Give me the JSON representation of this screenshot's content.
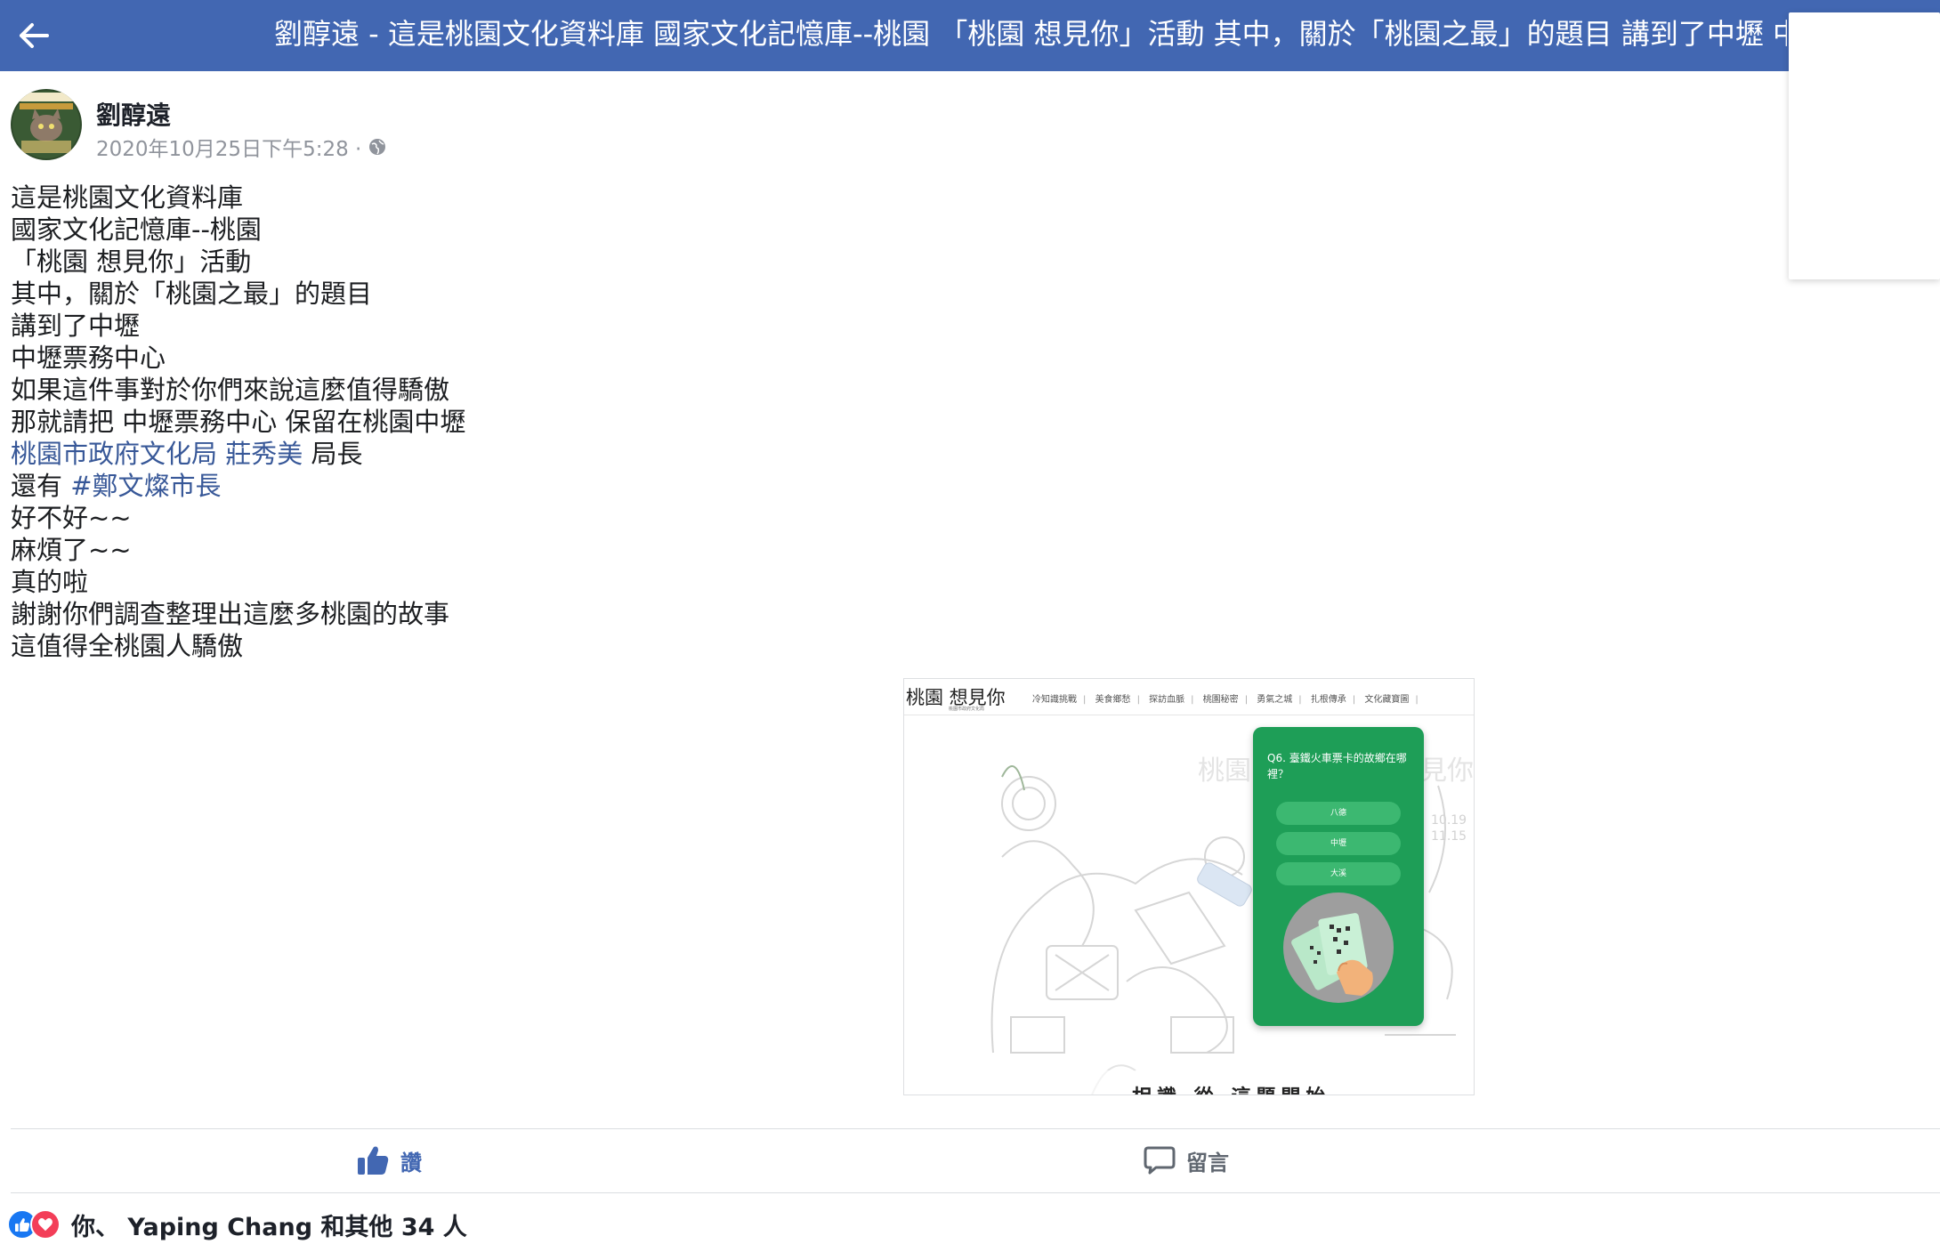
{
  "header": {
    "title": "劉醇遠 - 這是桃園文化資料庫 國家文化記憶庫--桃園 「桃園 想見你」活動 其中，關於「桃園之最」的題目 講到了中壢 中壢票務中心"
  },
  "post": {
    "author": "劉醇遠",
    "timestamp": "2020年10月25日下午5:28 ·",
    "lines": [
      "這是桃園文化資料庫",
      "國家文化記憶庫--桃園",
      "「桃園 想見你」活動",
      "其中，關於「桃園之最」的題目",
      "講到了中壢",
      "中壢票務中心",
      "如果這件事對於你們來說這麼值得驕傲",
      "那就請把 中壢票務中心 保留在桃園中壢"
    ],
    "tag_line": {
      "link1": "桃園市政府文化局",
      "link2": "莊秀美",
      "suffix": " 局長"
    },
    "hashtag_line": {
      "prefix": "還有 ",
      "hashtag": "#鄭文燦市長"
    },
    "lines_after": [
      "好不好~~",
      "麻煩了~~",
      "真的啦",
      "謝謝你們調查整理出這麼多桃園的故事",
      "這值得全桃園人驕傲"
    ]
  },
  "attachment": {
    "logo": "桃園 想見你",
    "logo_sub": "桃園市政府文化局",
    "menu": [
      "冷知識挑戰",
      "美食鄉愁",
      "探訪血脈",
      "桃園秘密",
      "勇氣之城",
      "扎根傳承",
      "文化藏寶圖"
    ],
    "ghost_left": "桃園",
    "ghost_right": "見你",
    "ghost_dates": "10.19\n11.15",
    "quiz_question": "Q6. 臺鐵火車票卡的故鄉在哪裡？",
    "quiz_options": [
      "八德",
      "中壢",
      "大溪"
    ],
    "bottom_text": "相識 從 這題開始"
  },
  "actions": {
    "like_label": "讚",
    "comment_label": "留言"
  },
  "reactions": {
    "summary": "你、 Yaping Chang 和其他 34 人"
  },
  "colors": {
    "header_bg": "#4267b2",
    "link": "#385898",
    "like": "#4267b2",
    "quiz_green": "#1e9e57"
  }
}
